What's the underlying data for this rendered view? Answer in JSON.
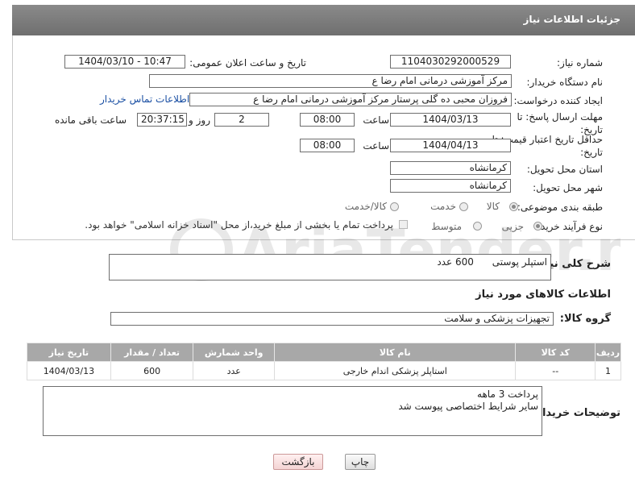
{
  "header": {
    "title": "جزئیات اطلاعات نیاز"
  },
  "fields": {
    "need_number_label": "شماره نیاز:",
    "need_number": "1104030292000529",
    "announce_label": "تاریخ و ساعت اعلان عمومی:",
    "announce_value": "1404/03/10 - 10:47",
    "buyer_org_label": "نام دستگاه خریدار:",
    "buyer_org": "مرکز آموزشی  درمانی امام رضا  ع",
    "creator_label": "ایجاد کننده درخواست:",
    "creator": "فروزان محبی ده گلی پرستار مرکز آموزشی  درمانی امام رضا  ع",
    "contact_link": "اطلاعات تماس خریدار",
    "reply_deadline_label": "مهلت ارسال پاسخ: تا تاریخ:",
    "reply_date": "1404/03/13",
    "time_label": "ساعت",
    "reply_time": "08:00",
    "days_value": "2",
    "days_label": "روز و",
    "remaining_value": "20:37:15",
    "remaining_label": "ساعت باقی مانده",
    "price_validity_label": "حداقل تاریخ اعتبار قیمت: تا تاریخ:",
    "price_date": "1404/04/13",
    "price_time": "08:00",
    "province_label": "استان محل تحویل:",
    "province": "کرمانشاه",
    "city_label": "شهر محل تحویل:",
    "city": "کرمانشاه",
    "category_label": "طبقه بندی موضوعی:",
    "category_options": [
      "کالا",
      "خدمت",
      "کالا/خدمت"
    ],
    "process_label": "نوع فرآیند خرید :",
    "process_options": [
      "جزیی",
      "متوسط"
    ],
    "payment_note": "پرداخت تمام یا بخشی از مبلغ خرید،از محل \"اسناد خزانه اسلامی\" خواهد بود."
  },
  "description": {
    "label": "شرح کلی نیاز:",
    "value": "استپلر پوستی      600 عدد"
  },
  "goods": {
    "section_title": "اطلاعات کالاهای مورد نیاز",
    "group_label": "گروه کالا:",
    "group_value": "تجهیزات پزشکی و سلامت",
    "columns": [
      "ردیف",
      "کد کالا",
      "نام کالا",
      "واحد شمارش",
      "تعداد / مقدار",
      "تاریخ نیاز"
    ],
    "rows": [
      [
        "1",
        "--",
        "استاپلر پزشکی اندام خارجی",
        "عدد",
        "600",
        "1404/03/13"
      ]
    ]
  },
  "buyer_notes": {
    "label": "توضیحات خریدار:",
    "value": "پرداخت 3 ماهه\nسایر شرایط اختصاصی پیوست شد"
  },
  "buttons": {
    "print": "چاپ",
    "back": "بازگشت"
  },
  "colors": {
    "header_bg": "#7a7a7a",
    "table_header_bg": "#a8a8a8",
    "link": "#1a4fa3"
  }
}
